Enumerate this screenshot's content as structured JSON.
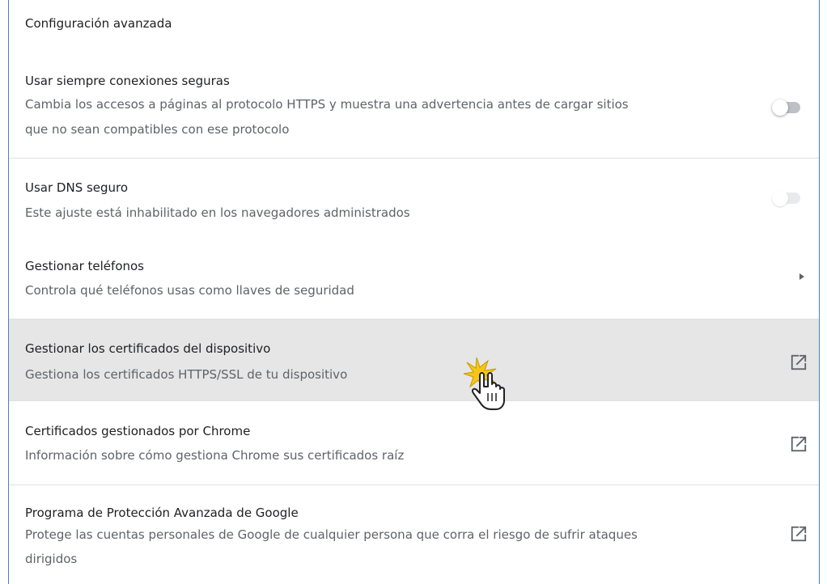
{
  "section": {
    "title": "Configuración avanzada"
  },
  "rows": [
    {
      "title": "Usar siempre conexiones seguras",
      "desc1": "Cambia los accesos a páginas al protocolo HTTPS y muestra una advertencia antes de cargar sitios",
      "desc2": "que no sean compatibles con ese protocolo",
      "control": "toggle",
      "state": "off"
    },
    {
      "title": "Usar DNS seguro",
      "desc1": "Este ajuste está inhabilitado en los navegadores administrados",
      "control": "toggle",
      "state": "disabled"
    },
    {
      "title": "Gestionar teléfonos",
      "desc1": "Controla qué teléfonos usas como llaves de seguridad",
      "control": "arrow-right-icon"
    },
    {
      "title": "Gestionar los certificados del dispositivo",
      "desc1": "Gestiona los certificados HTTPS/SSL de tu dispositivo",
      "control": "open-in-new-icon",
      "highlighted": true
    },
    {
      "title": "Certificados gestionados por Chrome",
      "desc1": "Información sobre cómo gestiona Chrome sus certificados raíz",
      "control": "open-in-new-icon"
    },
    {
      "title": "Programa de Protección Avanzada de Google",
      "desc1": "Protege las cuentas personales de Google de cualquier persona que corra el riesgo de sufrir ataques",
      "desc2": "dirigidos",
      "control": "open-in-new-icon"
    }
  ],
  "colors": {
    "frame_border": "#4a7fc1",
    "hover_background": "#e6e6e6",
    "text_primary": "#202124",
    "text_secondary": "#5f6368",
    "cursor_burst": "#f5c518"
  }
}
